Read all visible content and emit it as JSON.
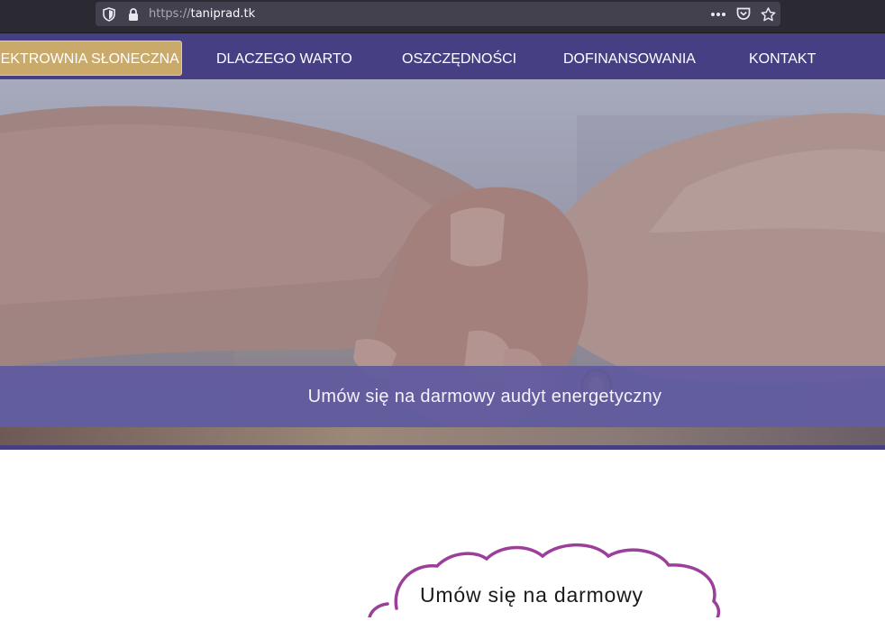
{
  "browser": {
    "url_scheme": "https://",
    "url_host": "taniprad.tk",
    "icons": [
      "shield-icon",
      "lock-icon",
      "more-dots-icon",
      "pocket-icon",
      "bookmark-star-icon"
    ]
  },
  "nav": {
    "active_label": "ELEKTROWNIA SŁONECZNA",
    "items": [
      {
        "label": "DLACZEGO WARTO"
      },
      {
        "label": "OSZCZĘDNOŚCI"
      },
      {
        "label": "DOFINANSOWANIA"
      },
      {
        "label": "KONTAKT"
      }
    ]
  },
  "hero": {
    "cta_text": "Umów się na darmowy audyt energetyczny"
  },
  "cloud": {
    "text": "Umów się na darmowy"
  },
  "colors": {
    "nav_bg": "#463f83",
    "nav_active_bg": "#c9aa6b",
    "cta_band": "#5f5aa0",
    "cloud_stroke": "#9b3f9b"
  }
}
